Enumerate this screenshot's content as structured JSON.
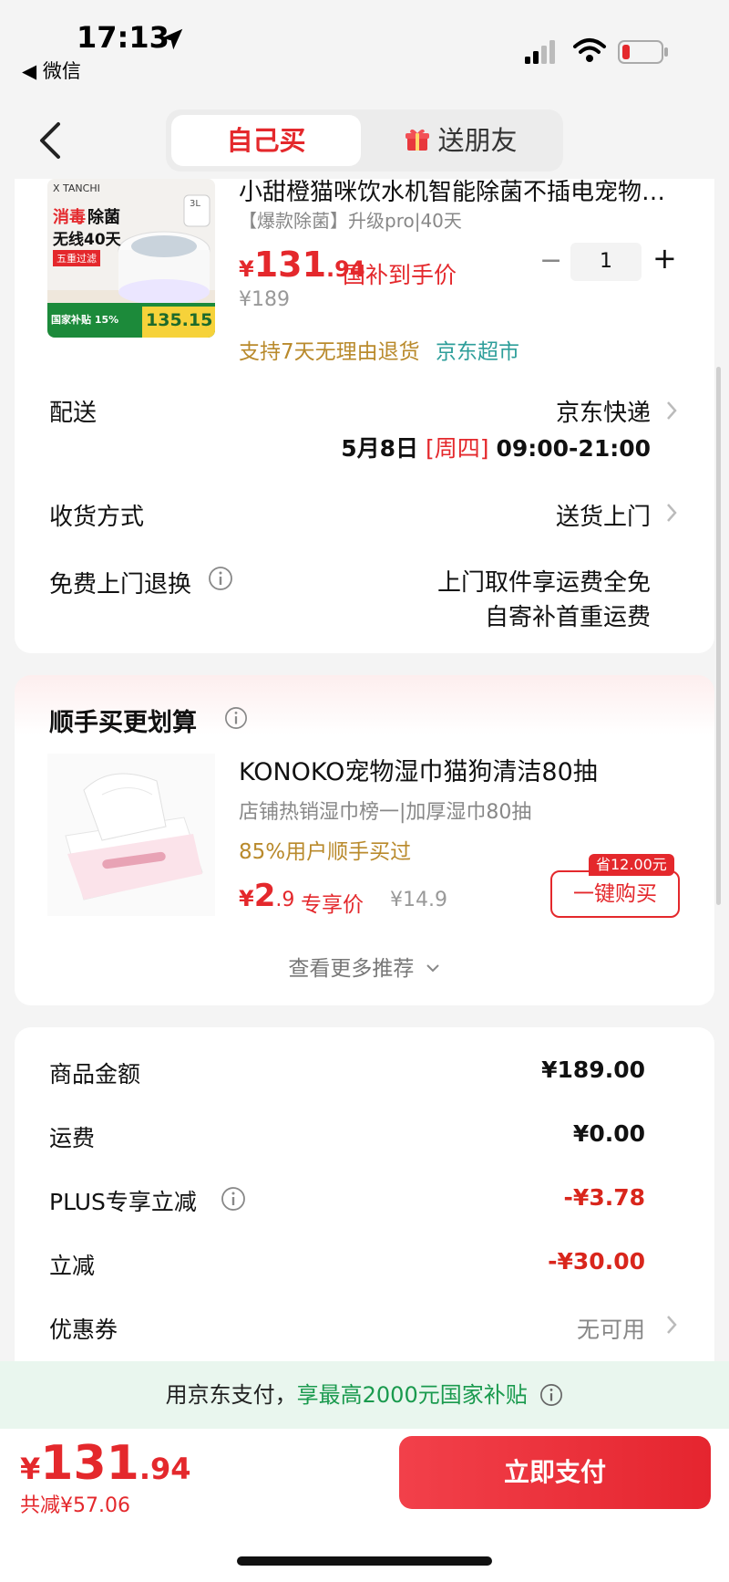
{
  "status_bar": {
    "time": "17:13",
    "back_app": "◀ 微信"
  },
  "nav": {
    "tab_self": "自己买",
    "tab_gift": "送朋友"
  },
  "product": {
    "title": "小甜橙猫咪饮水机智能除菌不插电宠物…",
    "spec": "【爆款除菌】升级pro|40天",
    "price_currency": "¥",
    "price_int": "131",
    "price_dec": ".94",
    "subsidy_label": "国补到手价",
    "original_price": "¥189",
    "quantity": "1",
    "qty_minus": "−",
    "qty_plus": "+",
    "tag_return": "支持7天无理由退货",
    "tag_store": "京东超市",
    "image": {
      "brand": "X TANCHI",
      "headline_red": "消毒",
      "headline_black": "除菌",
      "subline": "无线40天",
      "badge": "五重过滤",
      "capacity": "3L",
      "subsidy_text": "国家补贴 15%",
      "price": "135.15"
    }
  },
  "delivery": {
    "label": "配送",
    "carrier": "京东快递",
    "date": "5月8日",
    "weekday": "[周四]",
    "time_window": "09:00-21:00"
  },
  "receive": {
    "label": "收货方式",
    "value": "送货上门"
  },
  "free_return": {
    "label": "免费上门退换",
    "line1": "上门取件享运费全免",
    "line2": "自寄补首重运费"
  },
  "recommend": {
    "title": "顺手买更划算",
    "item_name": "KONOKO宠物湿巾猫狗清洁80抽",
    "item_desc": "店铺热销湿巾榜一|加厚湿巾80抽",
    "item_popularity": "85%用户顺手买过",
    "price_currency": "¥",
    "price_int": "2",
    "price_dec": ".9",
    "exclusive_label": "专享价",
    "original_price": "¥14.9",
    "save_badge": "省12.00元",
    "buy_button": "一键购买",
    "more": "查看更多推荐"
  },
  "summary": {
    "rows": [
      {
        "label": "商品金额",
        "value": "¥189.00"
      },
      {
        "label": "运费",
        "value": "¥0.00"
      },
      {
        "label": "PLUS专享立减",
        "value": "-¥3.78"
      },
      {
        "label": "立减",
        "value": "-¥30.00"
      },
      {
        "label": "优惠券",
        "value": "无可用"
      }
    ]
  },
  "banner": {
    "prefix": "用京东支付，",
    "highlight": "享最高2000元国家补贴"
  },
  "footer": {
    "total_currency": "¥",
    "total_int": "131",
    "total_dec": ".94",
    "saved": "共减¥57.06",
    "pay_button": "立即支付"
  },
  "colors": {
    "accent": "#e4282c",
    "gold": "#b98a2c",
    "teal": "#2d9e9a",
    "green": "#1a9a4e"
  }
}
